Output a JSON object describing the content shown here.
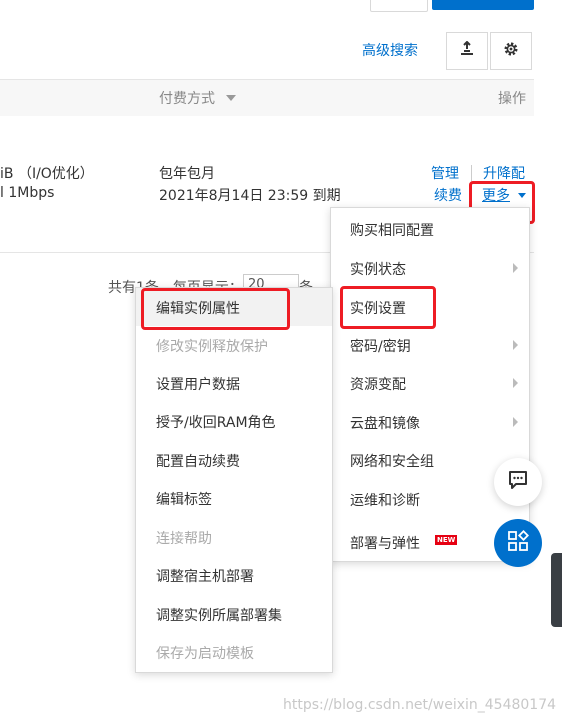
{
  "toolbar": {
    "advanced_search": "高级搜索",
    "export_icon": "export-icon",
    "settings_icon": "gear-icon"
  },
  "table": {
    "headers": {
      "payment": "付费方式",
      "actions": "操作"
    },
    "row": {
      "spec_line1": "iB （I/O优化）",
      "spec_line2": "l 1Mbps",
      "payment_type": "包年包月",
      "expire": "2021年8月14日 23:59 到期",
      "action_manage": "管理",
      "action_resize": "升降配",
      "action_renew": "续费",
      "action_more": "更多"
    }
  },
  "pager": {
    "left": "共有1条，每页显示：",
    "value": "20",
    "right": "条"
  },
  "more_menu": {
    "items": [
      {
        "label": "购买相同配置",
        "submenu": false
      },
      {
        "label": "实例状态",
        "submenu": true
      },
      {
        "label": "实例设置",
        "submenu": true
      },
      {
        "label": "密码/密钥",
        "submenu": true
      },
      {
        "label": "资源变配",
        "submenu": true
      },
      {
        "label": "云盘和镜像",
        "submenu": true
      },
      {
        "label": "网络和安全组",
        "submenu": true
      },
      {
        "label": "运维和诊断",
        "submenu": false
      },
      {
        "label": "部署与弹性",
        "submenu": false,
        "badge": "NEW"
      }
    ]
  },
  "settings_submenu": {
    "items": [
      {
        "label": "编辑实例属性",
        "disabled": false
      },
      {
        "label": "修改实例释放保护",
        "disabled": true
      },
      {
        "label": "设置用户数据",
        "disabled": false
      },
      {
        "label": "授予/收回RAM角色",
        "disabled": false
      },
      {
        "label": "配置自动续费",
        "disabled": false
      },
      {
        "label": "编辑标签",
        "disabled": false
      },
      {
        "label": "连接帮助",
        "disabled": true
      },
      {
        "label": "调整宿主机部署",
        "disabled": false
      },
      {
        "label": "调整实例所属部署集",
        "disabled": false
      },
      {
        "label": "保存为启动模板",
        "disabled": true
      }
    ]
  },
  "floating": {
    "chat_icon": "chat-icon",
    "apps_icon": "apps-icon"
  },
  "watermark": "https://blog.csdn.net/weixin_45480174",
  "colors": {
    "link": "#0070cc",
    "highlight": "#ee1c24",
    "float_blue": "#0070cc"
  }
}
